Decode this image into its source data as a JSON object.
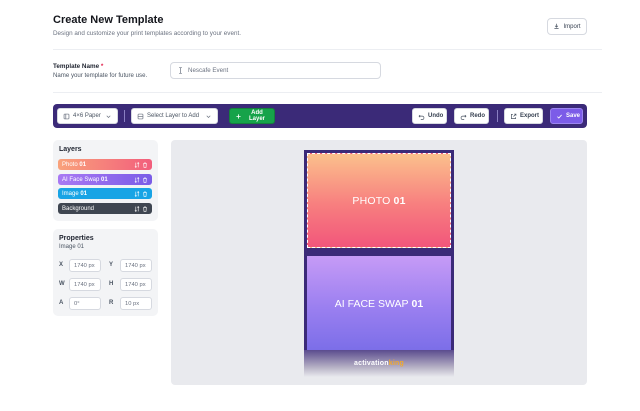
{
  "header": {
    "title": "Create New Template",
    "subtitle": "Design and customize your print templates according to your event.",
    "import_label": "Import"
  },
  "template_name": {
    "label": "Template Name",
    "required_mark": "*",
    "hint": "Name your template for future use.",
    "placeholder": "Nescafe Event",
    "value": ""
  },
  "toolbar": {
    "paper_label": "4×6 Paper",
    "layer_select_placeholder": "Select Layer to Add",
    "add_layer_label": "Add Layer",
    "undo_label": "Undo",
    "redo_label": "Redo",
    "export_label": "Export",
    "save_label": "Save"
  },
  "layers_panel": {
    "title": "Layers",
    "items": [
      {
        "name": "Photo",
        "number": "01"
      },
      {
        "name": "AI Face Swap",
        "number": "01"
      },
      {
        "name": "Image",
        "number": "01"
      },
      {
        "name": "Background",
        "number": ""
      }
    ]
  },
  "properties_panel": {
    "title": "Properties",
    "selected": "Image 01",
    "fields": {
      "x": {
        "label": "X",
        "value": "1740 px"
      },
      "y": {
        "label": "Y",
        "value": "1740 px"
      },
      "w": {
        "label": "W",
        "value": "1740 px"
      },
      "h": {
        "label": "H",
        "value": "1740 px"
      },
      "a": {
        "label": "A",
        "value": "0°"
      },
      "r": {
        "label": "R",
        "value": "10 px"
      }
    }
  },
  "canvas": {
    "photo_label": "PHOTO",
    "photo_number": "01",
    "aiface_label": "AI FACE SWAP",
    "aiface_number": "01",
    "brand_part1": "activation",
    "brand_part2": "king"
  },
  "colors": {
    "toolbar_bg": "#3b2a78",
    "accent_purple": "#7c5ce8",
    "add_green": "#16a34a",
    "image_blue": "#18a4e5",
    "brand_orange": "#f2a92b"
  }
}
